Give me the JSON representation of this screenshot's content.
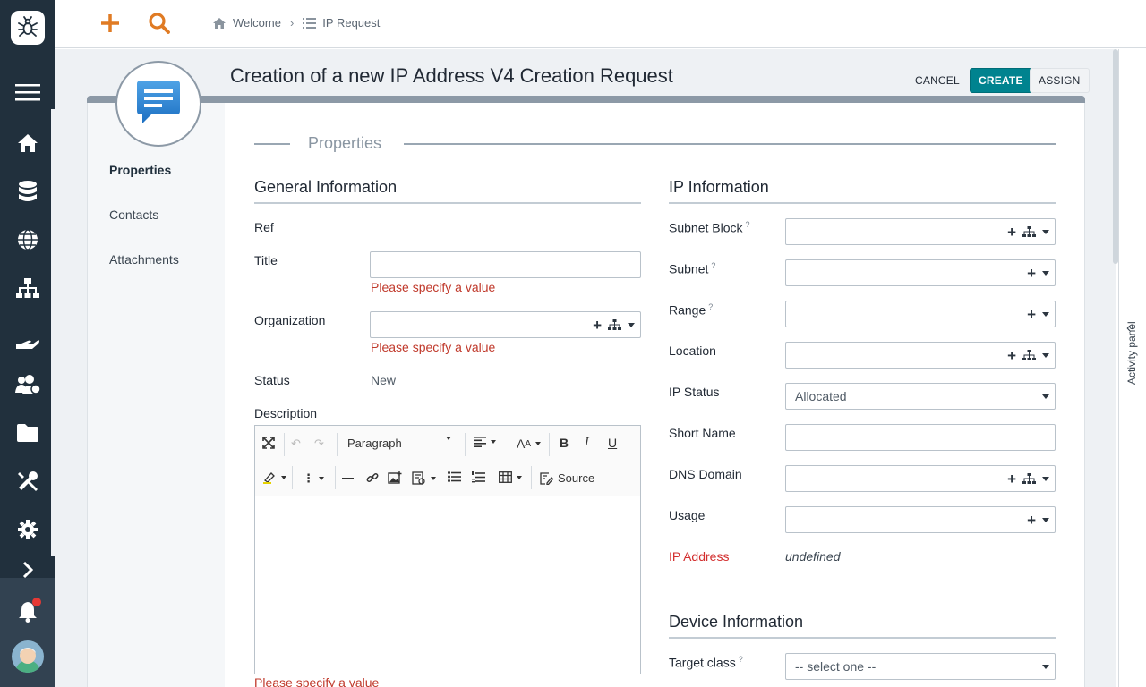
{
  "breadcrumb": {
    "home": "Welcome",
    "current": "IP Request"
  },
  "page": {
    "title": "Creation of a new IP Address V4 Creation Request",
    "buttons": {
      "cancel": "CANCEL",
      "create": "CREATE",
      "assign": "ASSIGN"
    }
  },
  "tabs": [
    "Properties",
    "Contacts",
    "Attachments"
  ],
  "fieldset": {
    "title": "Properties"
  },
  "general": {
    "title": "General Information",
    "ref_label": "Ref",
    "title_label": "Title",
    "org_label": "Organization",
    "status_label": "Status",
    "status_value": "New",
    "description_label": "Description",
    "error": "Please specify a value"
  },
  "editor": {
    "paragraph": "Paragraph",
    "source": "Source"
  },
  "ip": {
    "title": "IP Information",
    "subnet_block": "Subnet Block",
    "subnet": "Subnet",
    "range": "Range",
    "location": "Location",
    "ip_status": "IP Status",
    "ip_status_value": "Allocated",
    "short_name": "Short Name",
    "dns_domain": "DNS Domain",
    "usage": "Usage",
    "ip_address": "IP Address",
    "ip_address_value": "undefined",
    "hint": "?"
  },
  "device": {
    "title": "Device Information",
    "target_class": "Target class",
    "target_class_value": "-- select one --"
  },
  "activity_panel": "Activity panel",
  "colors": {
    "nav": "#21303d",
    "accent": "#e07b24",
    "create": "#00838f",
    "error": "#c0392b"
  }
}
